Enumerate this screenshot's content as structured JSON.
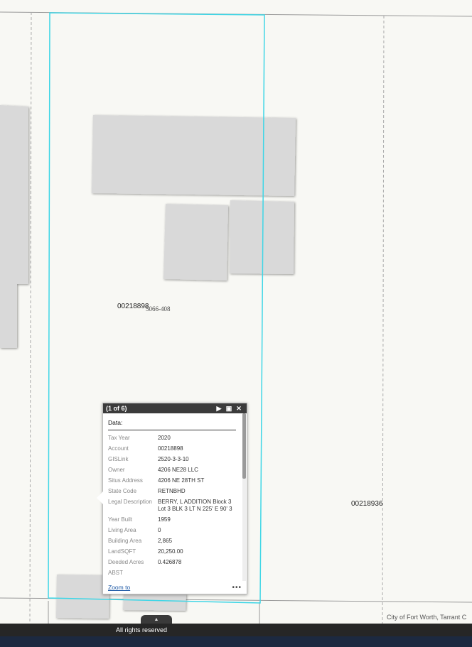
{
  "map": {
    "parcel_label_main": "00218898",
    "lot_label": "5066-408",
    "parcel_label_right": "00218936",
    "attribution": "City of Fort Worth, Tarrant C"
  },
  "popup": {
    "counter": "(1 of 6)",
    "next_icon": "play-next-icon",
    "maximize_icon": "maximize-icon",
    "close_icon": "close-icon",
    "title": "Data:",
    "fields": [
      {
        "key": "Tax Year",
        "value": "2020"
      },
      {
        "key": "Account",
        "value": "00218898"
      },
      {
        "key": "GISLink",
        "value": "2520-3-3-10"
      },
      {
        "key": "Owner",
        "value": "4206 NE28 LLC"
      },
      {
        "key": "Situs Address",
        "value": "4206 NE 28TH ST"
      },
      {
        "key": "State Code",
        "value": "RETNBHD"
      },
      {
        "key": "Legal Description",
        "value": "BERRY, L ADDITION Block 3 Lot 3 BLK 3 LT N 225' E 90' 3"
      },
      {
        "key": "Year Built",
        "value": "1959"
      },
      {
        "key": "Living Area",
        "value": "0"
      },
      {
        "key": "Building Area",
        "value": "2,865"
      },
      {
        "key": "LandSQFT",
        "value": "20,250.00"
      },
      {
        "key": "Deeded Acres",
        "value": "0.426878"
      },
      {
        "key": "ABST",
        "value": ""
      }
    ],
    "zoom_label": "Zoom to",
    "more_label": "•••"
  },
  "footer": {
    "text": "All rights reserved",
    "expand_icon": "chevron-up-icon"
  },
  "colors": {
    "parcel_highlight": "#3fd6e6",
    "building_fill": "#d9d9d9",
    "popup_header": "#3b3b3b",
    "footer_bar": "#262626",
    "bottom_strip": "#1c2940"
  }
}
